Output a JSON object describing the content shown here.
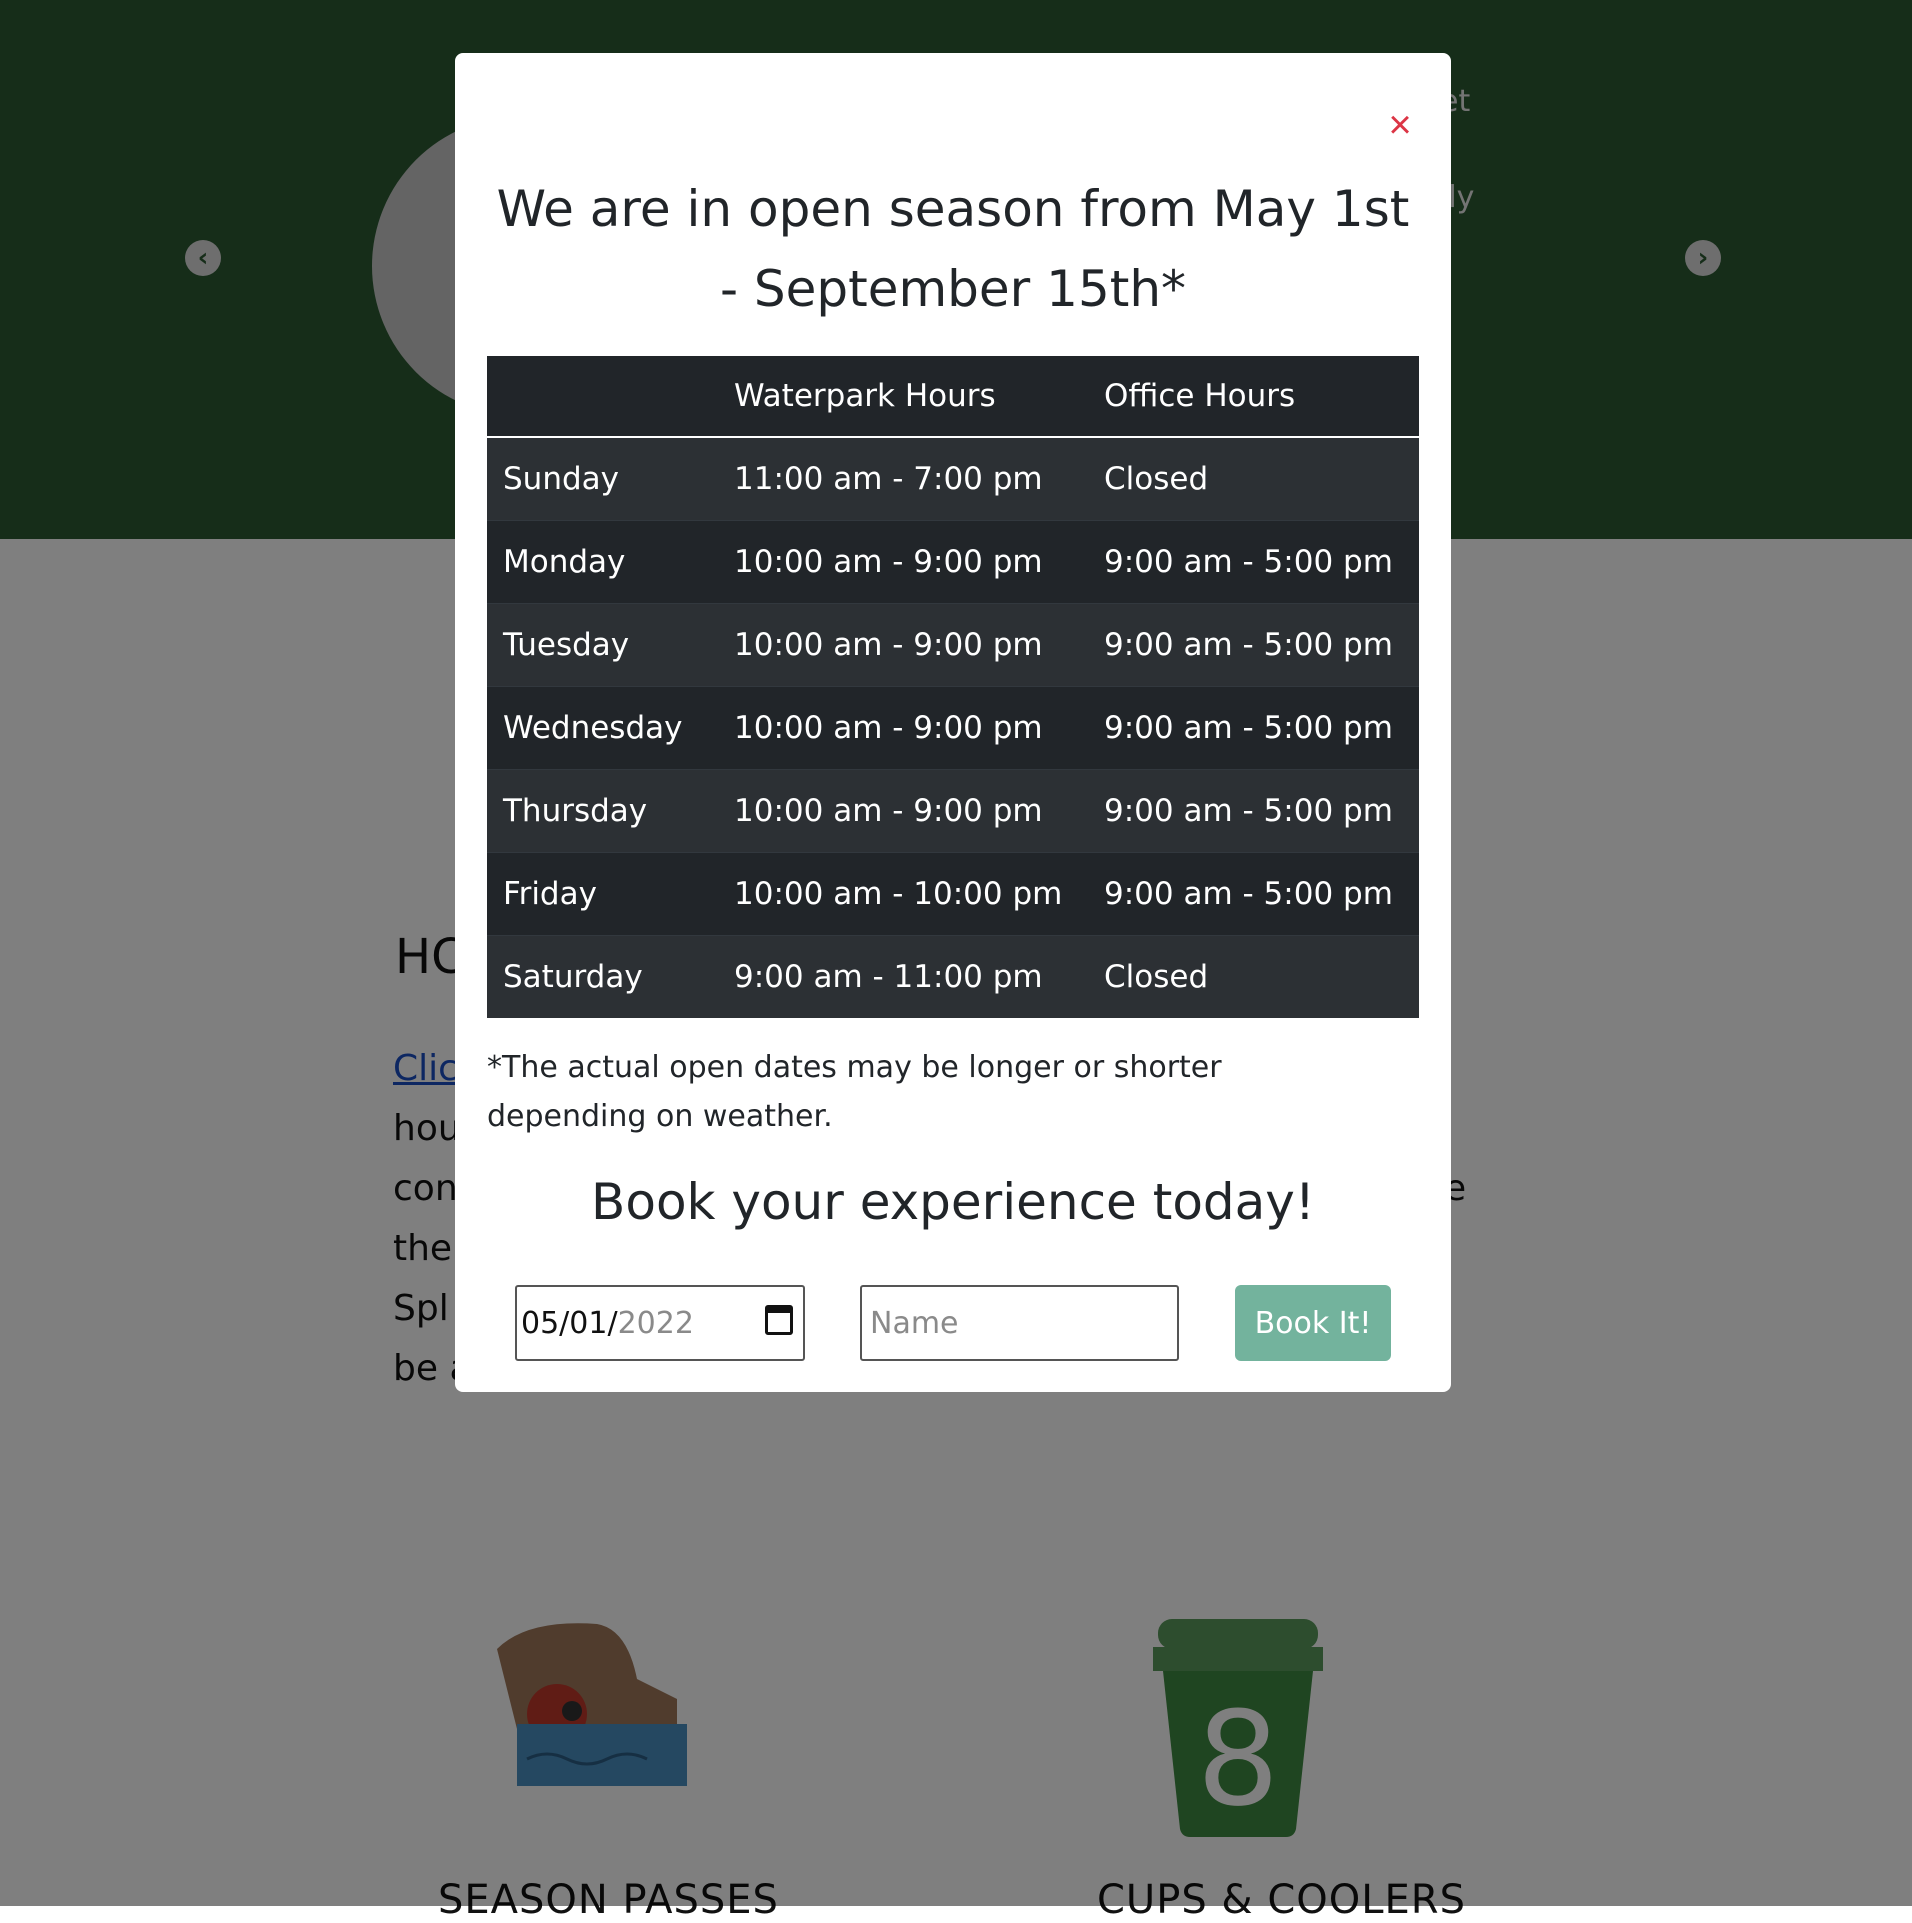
{
  "hero": {
    "partial_text_1": "et",
    "partial_text_2": "ily",
    "prev_arrow": "‹",
    "next_arrow": "›"
  },
  "page": {
    "hours_heading": "HC",
    "link_text": "Clic",
    "para_lines": [
      "hou",
      "con",
      "the",
      "Spl",
      "be a"
    ],
    "para_line3_tail": "re",
    "features": [
      {
        "icon": "swimmer-icon",
        "title": "SEASON PASSES"
      },
      {
        "icon": "cup-icon",
        "title": "CUPS & COOLERS"
      }
    ]
  },
  "modal": {
    "close_label": "×",
    "title": "We are in open season from May 1st - September 15th*",
    "table": {
      "headers": [
        "",
        "Waterpark Hours",
        "Office Hours"
      ],
      "rows": [
        [
          "Sunday",
          "11:00 am - 7:00 pm",
          "Closed"
        ],
        [
          "Monday",
          "10:00 am - 9:00 pm",
          "9:00 am - 5:00 pm"
        ],
        [
          "Tuesday",
          "10:00 am - 9:00 pm",
          "9:00 am - 5:00 pm"
        ],
        [
          "Wednesday",
          "10:00 am - 9:00 pm",
          "9:00 am - 5:00 pm"
        ],
        [
          "Thursday",
          "10:00 am - 9:00 pm",
          "9:00 am - 5:00 pm"
        ],
        [
          "Friday",
          "10:00 am - 10:00 pm",
          "9:00 am - 5:00 pm"
        ],
        [
          "Saturday",
          "9:00 am - 11:00 pm",
          "Closed"
        ]
      ]
    },
    "note": "*The actual open dates may be longer or shorter depending on weather.",
    "book_heading": "Book your experience today!",
    "date_value_md": "05/01/",
    "date_value_year": "2022",
    "name_placeholder": "Name",
    "book_button": "Book It!"
  },
  "colors": {
    "hero_green": "#2d5a33",
    "close_red": "#dc3545",
    "table_dark": "#212529",
    "book_button": "#73b39d"
  }
}
